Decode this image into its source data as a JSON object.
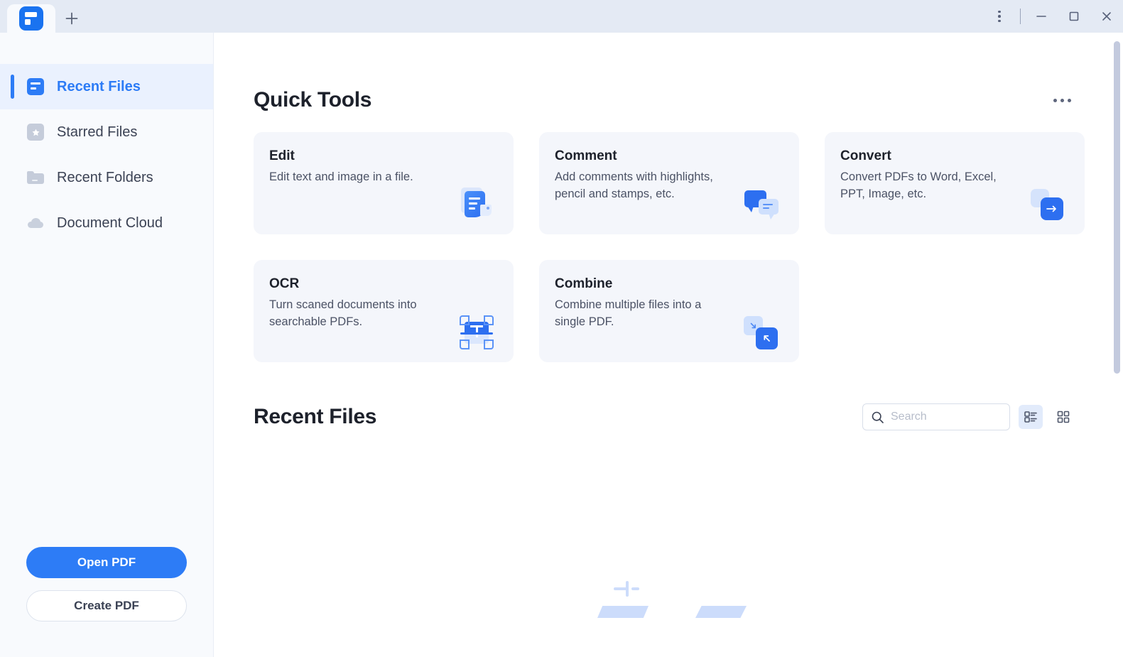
{
  "window": {
    "tab_logo_name": "app-logo",
    "new_tab_label": "+",
    "menu_label": "⋮",
    "minimize_label": "—",
    "maximize_label": "□",
    "close_label": "✕"
  },
  "sidebar": {
    "items": [
      {
        "label": "Recent Files",
        "icon": "recent-files-icon",
        "active": true
      },
      {
        "label": "Starred Files",
        "icon": "starred-files-icon",
        "active": false
      },
      {
        "label": "Recent Folders",
        "icon": "recent-folders-icon",
        "active": false
      },
      {
        "label": "Document Cloud",
        "icon": "document-cloud-icon",
        "active": false
      }
    ],
    "open_pdf_label": "Open PDF",
    "create_pdf_label": "Create PDF"
  },
  "quick_tools": {
    "title": "Quick Tools",
    "more_label": "More options",
    "cards": [
      {
        "name": "Edit",
        "desc": "Edit text and image in a file.",
        "icon": "edit-icon"
      },
      {
        "name": "Comment",
        "desc": "Add comments with highlights, pencil and stamps, etc.",
        "icon": "comment-icon"
      },
      {
        "name": "Convert",
        "desc": "Convert PDFs to Word, Excel, PPT, Image, etc.",
        "icon": "convert-icon"
      },
      {
        "name": "OCR",
        "desc": "Turn scaned documents into searchable PDFs.",
        "icon": "ocr-icon"
      },
      {
        "name": "Combine",
        "desc": "Combine multiple files into a single PDF.",
        "icon": "combine-icon"
      }
    ]
  },
  "recent_files": {
    "title": "Recent Files",
    "search_placeholder": "Search",
    "search_value": "",
    "view_list_label": "List view",
    "view_grid_label": "Grid view",
    "active_view": "list",
    "empty": true
  },
  "colors": {
    "accent": "#2d7cf6",
    "accent_dark": "#2d6ff0",
    "sidebar_bg": "#f8fafd",
    "titlebar_bg": "#e4eaf4",
    "card_bg": "#f4f6fb",
    "active_nav_bg": "#eaf1fe",
    "text_primary": "#1d212b",
    "text_secondary": "#4b5265",
    "empty_art": "#ccdcfb"
  }
}
